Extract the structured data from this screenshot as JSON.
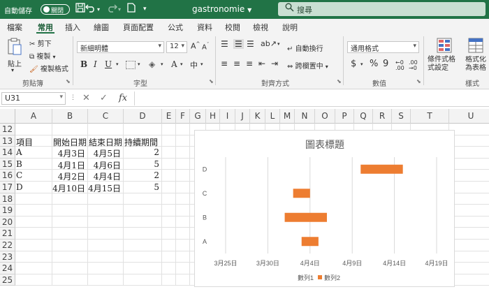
{
  "titlebar": {
    "autosave_label": "自動儲存",
    "autosave_state": "關閉",
    "doc_name": "gastronomie",
    "search_placeholder": "搜尋"
  },
  "tabs": [
    "檔案",
    "常用",
    "插入",
    "繪圖",
    "頁面配置",
    "公式",
    "資料",
    "校閱",
    "檢視",
    "說明"
  ],
  "active_tab": "常用",
  "ribbon": {
    "clipboard": {
      "paste": "貼上",
      "cut": "剪下",
      "copy": "複製",
      "format_painter": "複製格式",
      "label": "剪貼簿"
    },
    "font": {
      "name": "新細明體",
      "size": "12",
      "label": "字型"
    },
    "alignment": {
      "wrap": "自動換行",
      "merge": "跨欄置中",
      "label": "對齊方式"
    },
    "number": {
      "format": "通用格式",
      "label": "數值"
    },
    "styles": {
      "conditional": "條件式格式設定",
      "table": "格式化為表格",
      "label": "樣式"
    }
  },
  "formula_bar": {
    "cell_ref": "U31",
    "fx": "fx",
    "formula": ""
  },
  "columns": [
    "A",
    "B",
    "C",
    "D",
    "E",
    "F",
    "G",
    "H",
    "I",
    "J",
    "K",
    "L",
    "M",
    "N",
    "O",
    "P",
    "Q",
    "R",
    "S",
    "T",
    "U"
  ],
  "rows": [
    "12",
    "13",
    "14",
    "15",
    "16",
    "17",
    "18",
    "19",
    "20",
    "21",
    "22",
    "23",
    "24",
    "25"
  ],
  "table": {
    "headers": [
      "項目",
      "開始日期",
      "結束日期",
      "持續期間"
    ],
    "rows": [
      [
        "A",
        "4月3日",
        "4月5日",
        "2"
      ],
      [
        "B",
        "4月1日",
        "4月6日",
        "5"
      ],
      [
        "C",
        "4月2日",
        "4月4日",
        "2"
      ],
      [
        "D",
        "4月10日",
        "4月15日",
        "5"
      ]
    ]
  },
  "chart_data": {
    "type": "bar",
    "orientation": "horizontal",
    "stacked": true,
    "title": "圖表標題",
    "categories": [
      "A",
      "B",
      "C",
      "D"
    ],
    "series": [
      {
        "name": "數列1",
        "start": [
          "2024-04-03",
          "2024-04-01",
          "2024-04-02",
          "2024-04-10"
        ],
        "visible": false
      },
      {
        "name": "數列2",
        "values": [
          2,
          5,
          2,
          5
        ],
        "color": "#ED7D31"
      }
    ],
    "x_ticks": [
      "3月25日",
      "3月30日",
      "4月4日",
      "4月9日",
      "4月14日",
      "4月19日"
    ],
    "x_range": [
      "2024-03-25",
      "2024-04-19"
    ],
    "grid": true,
    "legend": "bottom"
  },
  "colors": {
    "accent": "#217346",
    "bar": "#ED7D31"
  }
}
